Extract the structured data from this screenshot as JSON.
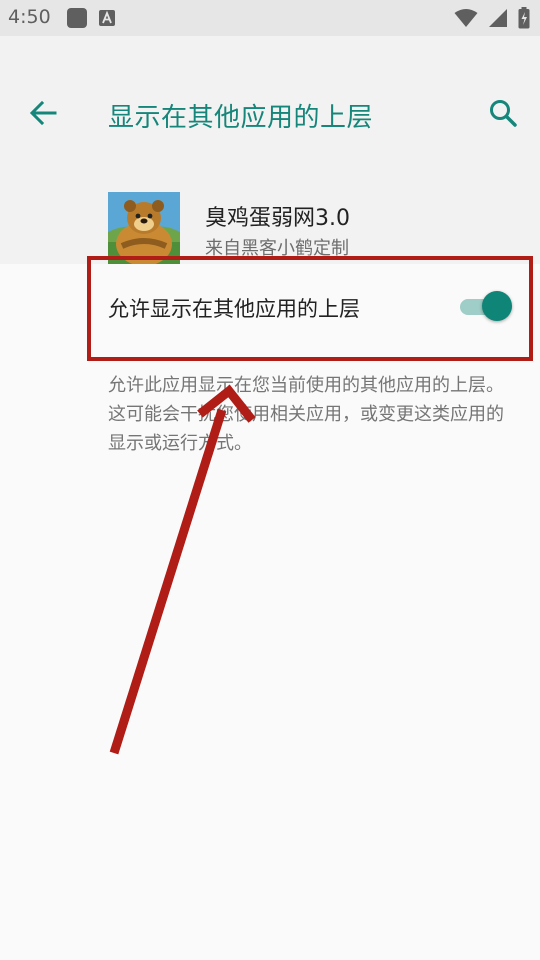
{
  "status_bar": {
    "time": "4:50"
  },
  "header": {
    "title": "显示在其他应用的上层"
  },
  "app": {
    "name": "臭鸡蛋弱网3.0",
    "source": "来自黑客小鹤定制"
  },
  "setting": {
    "label": "允许显示在其他应用的上层",
    "enabled": true,
    "description": "允许此应用显示在您当前使用的其他应用的上层。这可能会干扰您使用相关应用，或变更这类应用的显示或运行方式。"
  },
  "colors": {
    "accent": "#16867a",
    "switch_thumb": "#0e8577",
    "switch_track": "#9fcdc7",
    "annotation": "#b01c16"
  },
  "icons": [
    "back-arrow-icon",
    "search-icon",
    "wifi-icon",
    "battery-icon",
    "notification-icon"
  ]
}
